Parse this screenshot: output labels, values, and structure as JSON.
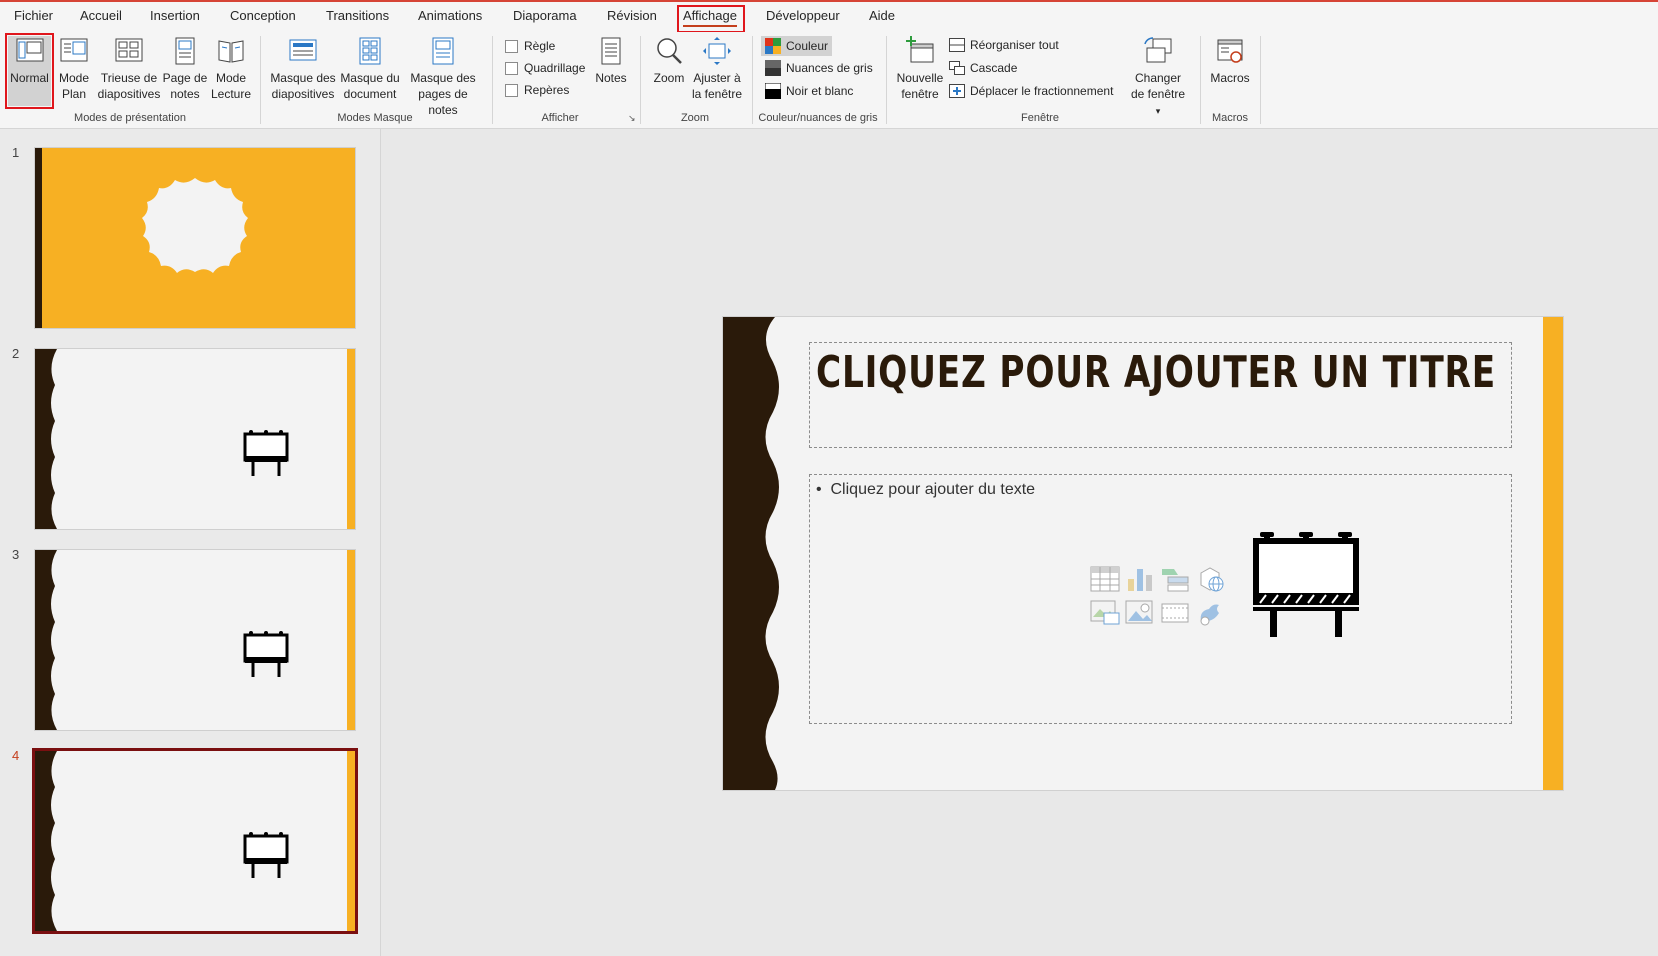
{
  "menu": {
    "items": [
      "Fichier",
      "Accueil",
      "Insertion",
      "Conception",
      "Transitions",
      "Animations",
      "Diaporama",
      "Révision",
      "Affichage",
      "Développeur",
      "Aide"
    ],
    "active": "Affichage"
  },
  "ribbon": {
    "presentation_views": {
      "normal": "Normal",
      "outline": "Mode Plan",
      "sorter": "Trieuse de diapositives",
      "notes_page": "Page de notes",
      "reading": "Mode Lecture",
      "label": "Modes de présentation"
    },
    "master_views": {
      "slide_master": "Masque des diapositives",
      "handout_master": "Masque du document",
      "notes_master": "Masque des pages de notes",
      "label": "Modes Masque"
    },
    "show": {
      "ruler": "Règle",
      "gridlines": "Quadrillage",
      "guides": "Repères",
      "notes": "Notes",
      "label": "Afficher"
    },
    "zoom": {
      "zoom": "Zoom",
      "fit": "Ajuster à la fenêtre",
      "label": "Zoom"
    },
    "color": {
      "color": "Couleur",
      "grayscale": "Nuances de gris",
      "bw": "Noir et blanc",
      "label": "Couleur/nuances de gris"
    },
    "window": {
      "new_window": "Nouvelle fenêtre",
      "arrange_all": "Réorganiser tout",
      "cascade": "Cascade",
      "move_split": "Déplacer le fractionnement",
      "switch_windows": "Changer de fenêtre",
      "label": "Fenêtre"
    },
    "macros": {
      "macros": "Macros",
      "label": "Macros"
    }
  },
  "thumbnails": [
    "1",
    "2",
    "3",
    "4"
  ],
  "current_slide": "4",
  "slide": {
    "title_placeholder": "CLIQUEZ POUR AJOUTER UN TITRE",
    "body_placeholder": "Cliquez pour ajouter du texte",
    "bullet": "•"
  },
  "colors": {
    "accent_orange": "#f7b023",
    "dark_brown": "#2a1a0a",
    "active_tab": "#c43e1c",
    "highlight_red": "#e0161c"
  }
}
